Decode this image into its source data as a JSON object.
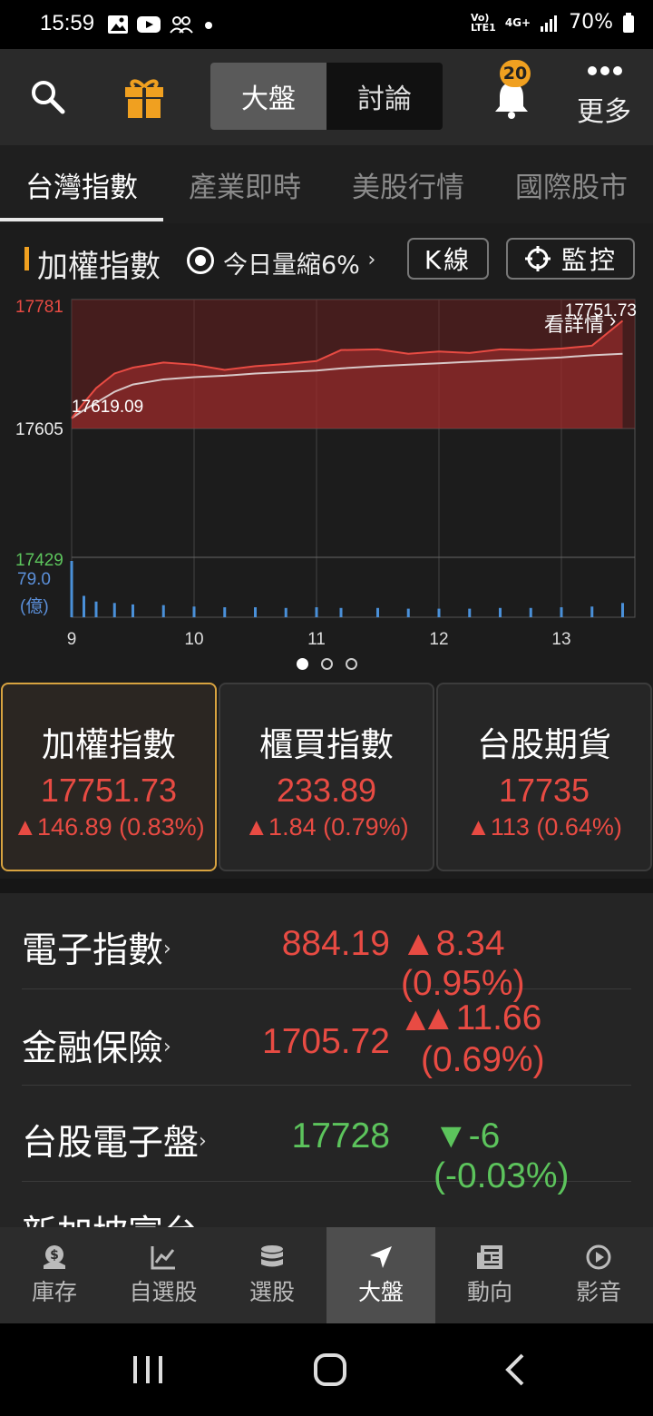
{
  "status": {
    "time": "15:59",
    "net_top": "Vo)",
    "net_bottom": "LTE1",
    "g4": "4G+",
    "battery": "70%"
  },
  "header": {
    "seg_market": "大盤",
    "seg_discuss": "討論",
    "badge": "20",
    "more": "更多"
  },
  "tabs": [
    "台灣指數",
    "產業即時",
    "美股行情",
    "國際股市"
  ],
  "index_row": {
    "title": "加權指數",
    "volume_note": "今日量縮6%",
    "kline": "K線",
    "monitor": "監控"
  },
  "chart_data": {
    "type": "line",
    "y_labels": {
      "high": "17781",
      "ref": "17605",
      "low": "17429"
    },
    "volume_labels": {
      "max": "79.0",
      "unit": "(億)"
    },
    "x_ticks": [
      "9",
      "10",
      "11",
      "12",
      "13"
    ],
    "annotations": {
      "last": "17751.73",
      "open": "17619.09",
      "detail": "看詳情"
    },
    "ylim": [
      17429,
      17781
    ],
    "x": [
      9.0,
      9.1,
      9.2,
      9.35,
      9.5,
      9.75,
      10.0,
      10.25,
      10.5,
      10.75,
      11.0,
      11.2,
      11.5,
      11.75,
      12.0,
      12.25,
      12.5,
      12.75,
      13.0,
      13.25,
      13.5
    ],
    "series": [
      {
        "values": [
          17619,
          17640,
          17660,
          17680,
          17688,
          17695,
          17692,
          17685,
          17690,
          17693,
          17697,
          17712,
          17713,
          17707,
          17710,
          17708,
          17713,
          17712,
          17714,
          17718,
          17752
        ]
      },
      {
        "values": [
          17619,
          17630,
          17640,
          17655,
          17665,
          17672,
          17675,
          17677,
          17680,
          17682,
          17684,
          17687,
          17690,
          17692,
          17694,
          17696,
          17698,
          17700,
          17702,
          17705,
          17707
        ]
      }
    ],
    "volume": [
      79,
      30,
      22,
      20,
      18,
      17,
      15,
      14,
      14,
      13,
      14,
      13,
      13,
      12,
      12,
      12,
      13,
      13,
      14,
      15,
      20
    ]
  },
  "pager_count": 3,
  "cards": [
    {
      "name": "加權指數",
      "value": "17751.73",
      "change": "▲146.89 (0.83%)"
    },
    {
      "name": "櫃買指數",
      "value": "233.89",
      "change": "▲1.84 (0.79%)"
    },
    {
      "name": "台股期貨",
      "value": "17735",
      "change": "▲113 (0.64%)"
    }
  ],
  "list": [
    {
      "name": "電子指數",
      "value": "884.19",
      "change": "▲8.34 (0.95%)"
    },
    {
      "name": "金融保險",
      "value": "1705.72",
      "change_line1": "▲11.66",
      "change_line2": "(0.69%)"
    },
    {
      "name": "台股電子盤",
      "value": "17728",
      "change": "▼-6 (-0.03%)"
    },
    {
      "name": "新加坡富台"
    }
  ],
  "nav": [
    "庫存",
    "自選股",
    "選股",
    "大盤",
    "動向",
    "影音"
  ],
  "colors": {
    "up": "#e84b43",
    "down": "#5cc45c",
    "accent": "#f0a020"
  }
}
